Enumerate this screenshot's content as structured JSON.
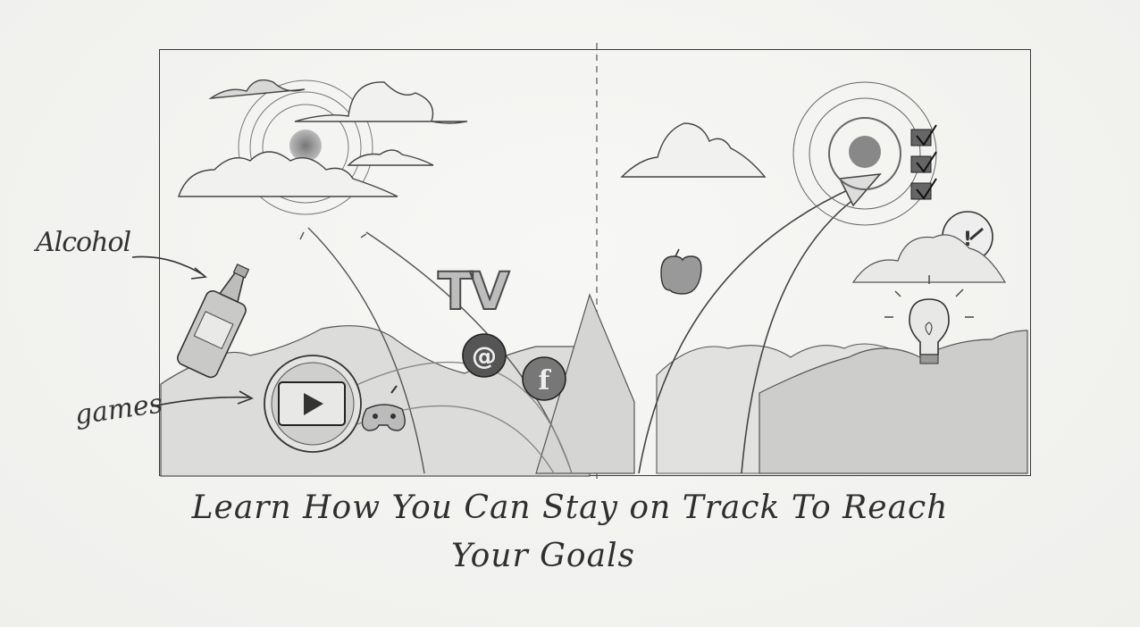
{
  "annotations": {
    "alcohol": "Alcohol",
    "games": "games"
  },
  "scene": {
    "tv": "TV",
    "at_symbol": "@",
    "facebook_symbol": "f",
    "warning_symbol": "!"
  },
  "tagline": {
    "line1": "Learn How You Can Stay on Track To Reach",
    "line2": "Your Goals"
  },
  "colors": {
    "pencil": "#3a3a3a",
    "shade": "#8a8a8a",
    "paper": "#f4f4f2"
  },
  "icons": [
    "bottle-icon",
    "play-icon",
    "gamepad-icon",
    "at-icon",
    "facebook-icon",
    "apple-icon",
    "target-icon",
    "checkbox-icon",
    "gauge-icon",
    "lightbulb-icon",
    "cloud-icon",
    "sun-icon",
    "mountain-icon"
  ]
}
